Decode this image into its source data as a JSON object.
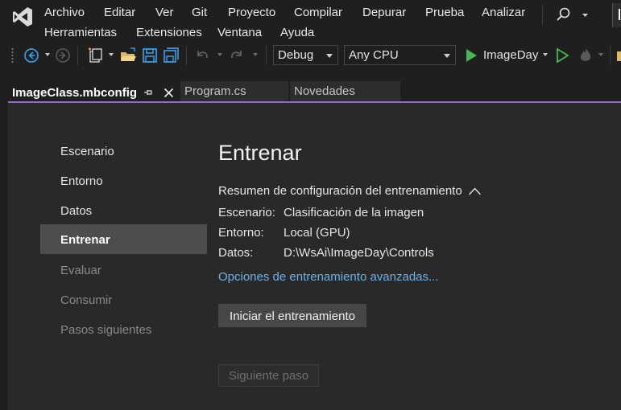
{
  "menu": {
    "items": [
      "Archivo",
      "Editar",
      "Ver",
      "Git",
      "Proyecto",
      "Compilar",
      "Depurar",
      "Prueba",
      "Analizar",
      "Herramientas",
      "Extensiones",
      "Ventana",
      "Ayuda"
    ]
  },
  "toolbar": {
    "configuration": "Debug",
    "platform": "Any CPU",
    "startup_project": "ImageDay"
  },
  "tabs": [
    {
      "label": "ImageClass.mbconfig",
      "active": true
    },
    {
      "label": "Program.cs",
      "active": false
    },
    {
      "label": "Novedades",
      "active": false
    }
  ],
  "sidebar": {
    "items": [
      {
        "label": "Escenario",
        "state": "normal"
      },
      {
        "label": "Entorno",
        "state": "normal"
      },
      {
        "label": "Datos",
        "state": "normal"
      },
      {
        "label": "Entrenar",
        "state": "selected"
      },
      {
        "label": "Evaluar",
        "state": "disabled"
      },
      {
        "label": "Consumir",
        "state": "disabled"
      },
      {
        "label": "Pasos siguientes",
        "state": "disabled"
      }
    ]
  },
  "main": {
    "title": "Entrenar",
    "summary_heading": "Resumen de configuración del entrenamiento",
    "summary": [
      {
        "key": "Escenario:",
        "value": "Clasificación de la imagen"
      },
      {
        "key": "Entorno:",
        "value": "Local (GPU)"
      },
      {
        "key": "Datos:",
        "value": "D:\\WsAi\\ImageDay\\Controls"
      }
    ],
    "advanced_link": "Opciones de entrenamiento avanzadas...",
    "start_button": "Iniciar el entrenamiento",
    "next_button": "Siguiente paso"
  },
  "colors": {
    "accent": "#8f6ac8",
    "link": "#6fb0e6",
    "run_green": "#3fb950",
    "save_blue": "#3a96dd"
  },
  "icons": [
    "vs-logo-icon",
    "search-icon",
    "back-icon",
    "forward-icon",
    "new-project-icon",
    "open-folder-icon",
    "save-icon",
    "save-all-icon",
    "undo-icon",
    "redo-icon",
    "start-debug-icon",
    "start-without-debug-icon",
    "hot-reload-icon",
    "pin-icon",
    "close-icon",
    "chevron-up-icon"
  ]
}
